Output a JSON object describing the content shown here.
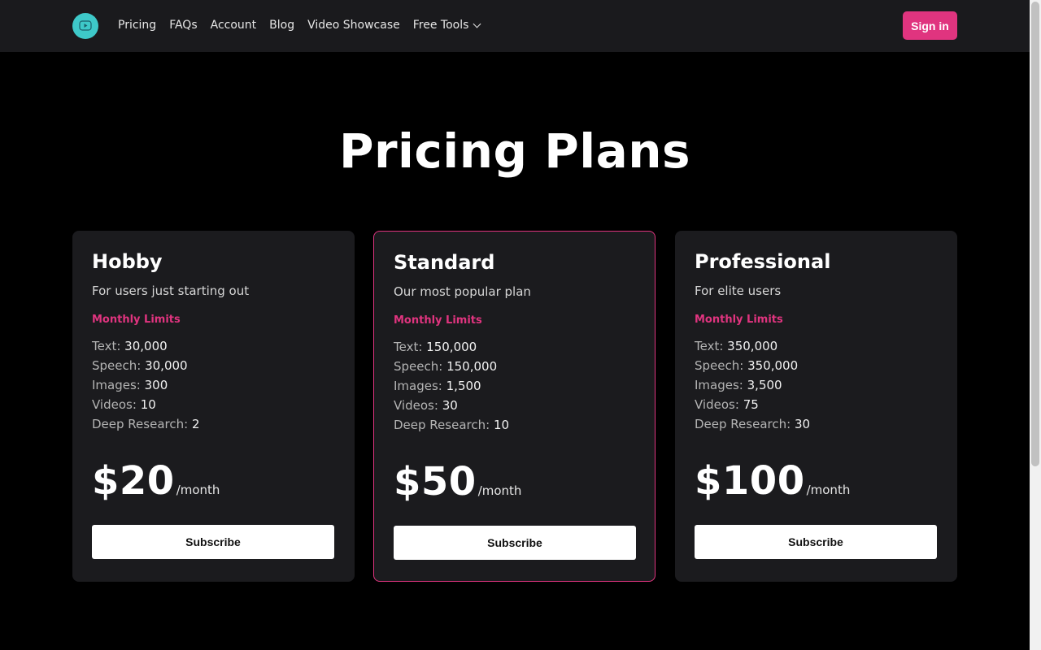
{
  "nav": {
    "logo_icon": "play-bubble-icon",
    "links": [
      "Pricing",
      "FAQs",
      "Account",
      "Blog",
      "Video Showcase"
    ],
    "dropdown_label": "Free Tools",
    "signin_label": "Sign in"
  },
  "page": {
    "title": "Pricing Plans"
  },
  "plans": [
    {
      "name": "Hobby",
      "description": "For users just starting out",
      "limits_title": "Monthly Limits",
      "limits": [
        {
          "label": "Text:",
          "value": "30,000"
        },
        {
          "label": "Speech:",
          "value": "30,000"
        },
        {
          "label": "Images:",
          "value": "300"
        },
        {
          "label": "Videos:",
          "value": "10"
        },
        {
          "label": "Deep Research:",
          "value": "2"
        }
      ],
      "price": "$20",
      "period": "/month",
      "button": "Subscribe"
    },
    {
      "name": "Standard",
      "description": "Our most popular plan",
      "limits_title": "Monthly Limits",
      "limits": [
        {
          "label": "Text:",
          "value": "150,000"
        },
        {
          "label": "Speech:",
          "value": "150,000"
        },
        {
          "label": "Images:",
          "value": "1,500"
        },
        {
          "label": "Videos:",
          "value": "30"
        },
        {
          "label": "Deep Research:",
          "value": "10"
        }
      ],
      "price": "$50",
      "period": "/month",
      "button": "Subscribe"
    },
    {
      "name": "Professional",
      "description": "For elite users",
      "limits_title": "Monthly Limits",
      "limits": [
        {
          "label": "Text:",
          "value": "350,000"
        },
        {
          "label": "Speech:",
          "value": "350,000"
        },
        {
          "label": "Images:",
          "value": "3,500"
        },
        {
          "label": "Videos:",
          "value": "75"
        },
        {
          "label": "Deep Research:",
          "value": "30"
        }
      ],
      "price": "$100",
      "period": "/month",
      "button": "Subscribe"
    }
  ],
  "colors": {
    "accent": "#e0347f",
    "logo": "#3ec9c9",
    "card_bg": "#1b1b1e",
    "nav_bg": "#1a1a1d"
  }
}
